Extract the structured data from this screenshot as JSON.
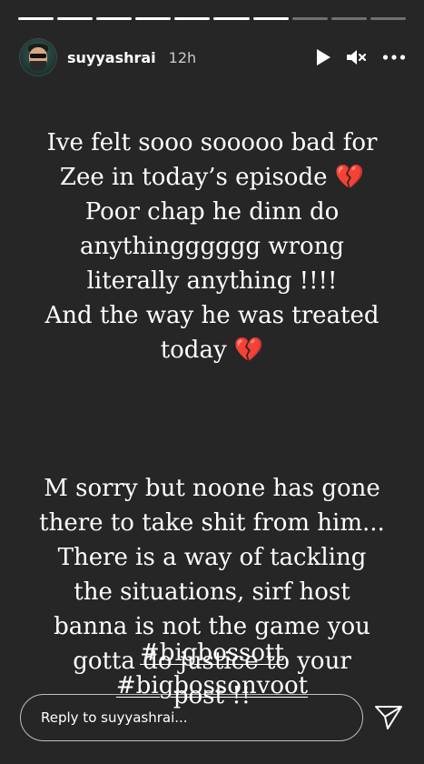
{
  "progress": {
    "segments": 10,
    "completed": 7
  },
  "header": {
    "username": "suyyashrai",
    "time": "12h",
    "avatar_icon": "profile-avatar",
    "play_icon": "play-icon",
    "mute_icon": "speaker-muted-icon",
    "more_icon": "more-options-icon"
  },
  "story": {
    "paragraph1": "Ive felt sooo sooooo bad for\nZee in today’s episode 💔\nPoor chap he dinn do\nanythingggggg wrong\nliterally anything !!!!\nAnd the way he was treated\ntoday 💔",
    "paragraph2": "M sorry but noone has gone\nthere to take shit from him...\nThere is a way of tackling\nthe situations, sirf host\nbanna is not the game you\ngotta do justice to your\npost !!"
  },
  "hashtags": [
    "#bigbossott",
    "#bigbossonvoot"
  ],
  "footer": {
    "reply_placeholder": "Reply to suyyashrai...",
    "send_icon": "send-icon"
  },
  "colors": {
    "background": "#262626",
    "text": "#ffffff",
    "heart": "#e0245e"
  }
}
